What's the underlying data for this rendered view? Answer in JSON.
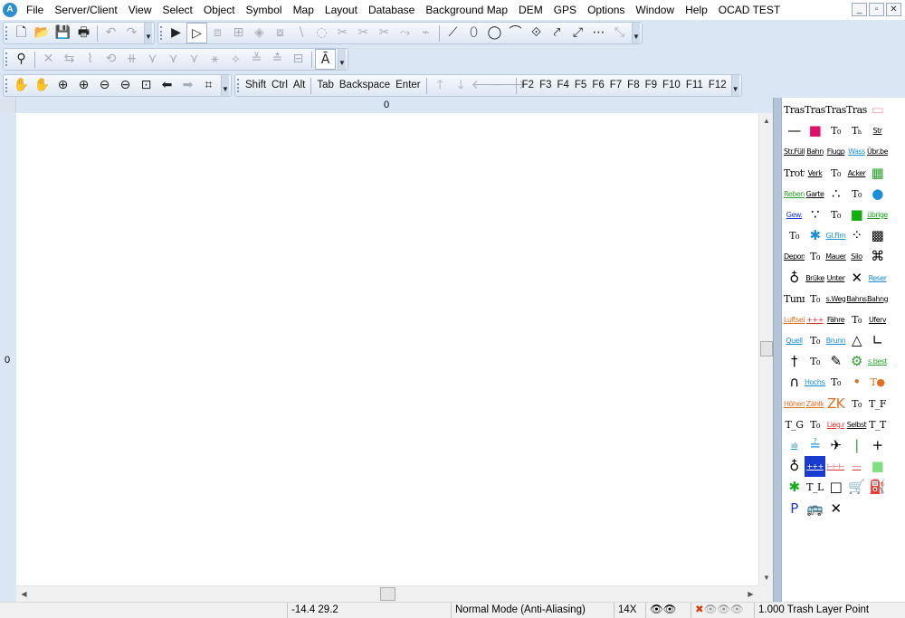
{
  "app": {
    "icon": "ocad-app-icon",
    "title_menu": "OCAD TEST"
  },
  "menu": [
    "File",
    "Server/Client",
    "View",
    "Select",
    "Object",
    "Symbol",
    "Map",
    "Layout",
    "Database",
    "Background Map",
    "DEM",
    "GPS",
    "Options",
    "Window",
    "Help",
    "OCAD TEST"
  ],
  "window_buttons": {
    "minimize": "_",
    "restore": "▫",
    "close": "✕"
  },
  "toolbar1": {
    "file_icons": [
      "🗋",
      "📂",
      "💾",
      "🖶"
    ],
    "edit_icons": [
      "↶",
      "↷"
    ],
    "draw_icons": [
      "▶",
      "▷",
      "⧈",
      "⊞",
      "◈",
      "⧇",
      "∖",
      "◌",
      "✂",
      "✂",
      "✂",
      "⤳",
      "⌁",
      "⟋",
      "⬯",
      "◯",
      "⌒",
      "⟐",
      "⤤",
      "⤢",
      "⋯",
      "⤡"
    ]
  },
  "toolbar2": {
    "icons": [
      "⚲",
      "✕",
      "⇆",
      "⌇",
      "⟲",
      "⧺",
      "⋎",
      "⋎",
      "⋎",
      "⚹",
      "⟡",
      "≚",
      "≛",
      "⊟",
      "Ā"
    ]
  },
  "toolbar3": {
    "view_icons": [
      "✋",
      "✋",
      "⊕",
      "⊕",
      "⊖",
      "⊖",
      "⊡",
      "⬅",
      "➡",
      "⌗"
    ],
    "keys_modifiers": [
      "Shift",
      "Ctrl",
      "Alt"
    ],
    "keys_editing": [
      "Tab",
      "Backspace",
      "Enter"
    ],
    "arrow_icons": [
      "🡑",
      "🡓",
      "🡐",
      "🡒"
    ],
    "function_keys": [
      "F2",
      "F3",
      "F4",
      "F5",
      "F6",
      "F7",
      "F8",
      "F9",
      "F10",
      "F11",
      "F12"
    ]
  },
  "rulers": {
    "top_label": "0",
    "left_label": "0"
  },
  "symbols": [
    "Trash",
    "Trash",
    "Trash",
    "Trash",
    "▭",
    "—",
    "■",
    "T₀",
    "Tₕ",
    "Str",
    "Str.Füll",
    "Bahn",
    "Flugp",
    "Wass",
    "Übr.be",
    "Trott",
    "Verk",
    "T₀",
    "Acker",
    "▦",
    "Reben",
    "Garte",
    "∴",
    "T₀",
    "●",
    "Gew.",
    "∵",
    "T₀",
    "■",
    "übrige",
    "T₀",
    "✱",
    "Gl.Firn",
    "⁘",
    "▩",
    "Depon",
    "T₀",
    "Mauer",
    "Silo",
    "⌘",
    "♁",
    "Brüke",
    "Unter",
    "✕",
    "Reser",
    "Tunnel",
    "T₀",
    "s.Weg",
    "Bahns",
    "Bahng",
    "Luftseil",
    "+++",
    "Fähre",
    "T₀",
    "Uferv",
    "Quell",
    "T₀",
    "Brunn",
    "△",
    "∟",
    "†",
    "T₀",
    "✎",
    "⚙",
    "s.best",
    "∩",
    "Hochsp",
    "T₀",
    "•",
    "T●",
    "Höhenl",
    "Zählk",
    "ZK",
    "T₀",
    "T_F",
    "T_G",
    "T₀",
    "Lieg.r",
    "Selbst",
    "T_T",
    "ıılı",
    "≟",
    "✈",
    "|",
    "+",
    "♁",
    "+++",
    "⊢⊢⊢",
    "‐‐‐‐",
    "■",
    "✱",
    "T_L",
    "□",
    "🛒",
    "⛽",
    "P",
    "🚌",
    "✕"
  ],
  "symbol_selected_index": 86,
  "status": {
    "cell_empty_left": "",
    "coordinates": "-14.4   29.2",
    "mode": "Normal Mode (Anti-Aliasing)",
    "zoom": "14X",
    "layer_info": "1.000 Trash Layer Point"
  },
  "colors": {
    "toolbar_bg": "#dbe6f4",
    "selected_symbol": "#1a3bd0"
  }
}
